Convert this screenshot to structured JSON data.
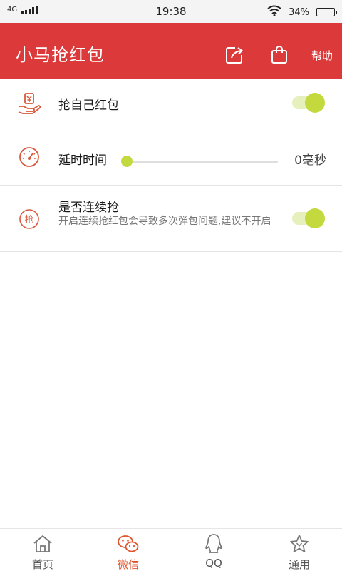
{
  "status_bar": {
    "network": "4G",
    "time": "19:38",
    "battery_text": "34%",
    "battery_level": 0.34
  },
  "app_bar": {
    "title": "小马抢红包",
    "help_label": "帮助",
    "share_icon": "share-icon",
    "bag_icon": "bag-icon"
  },
  "settings": {
    "grab_own": {
      "label": "抢自己红包",
      "enabled": true,
      "icon": "hand-red-envelope-icon"
    },
    "delay": {
      "label": "延时时间",
      "value_text": "0毫秒",
      "value": 0,
      "icon": "speedometer-icon"
    },
    "continuous": {
      "label": "是否连续抢",
      "description": "开启连续抢红包会导致多次弹包问题,建议不开启",
      "icon_text": "抢",
      "enabled": true
    }
  },
  "bottom_nav": {
    "items": [
      {
        "label": "首页",
        "icon": "home-icon",
        "active": false
      },
      {
        "label": "微信",
        "icon": "wechat-icon",
        "active": true
      },
      {
        "label": "QQ",
        "icon": "qq-penguin-icon",
        "active": false
      },
      {
        "label": "通用",
        "icon": "star-icon",
        "active": false
      }
    ]
  },
  "colors": {
    "primary": "#dc3a3a",
    "accent": "#c4d93e",
    "nav_active": "#e2552c",
    "icon_red": "#d9593b"
  }
}
